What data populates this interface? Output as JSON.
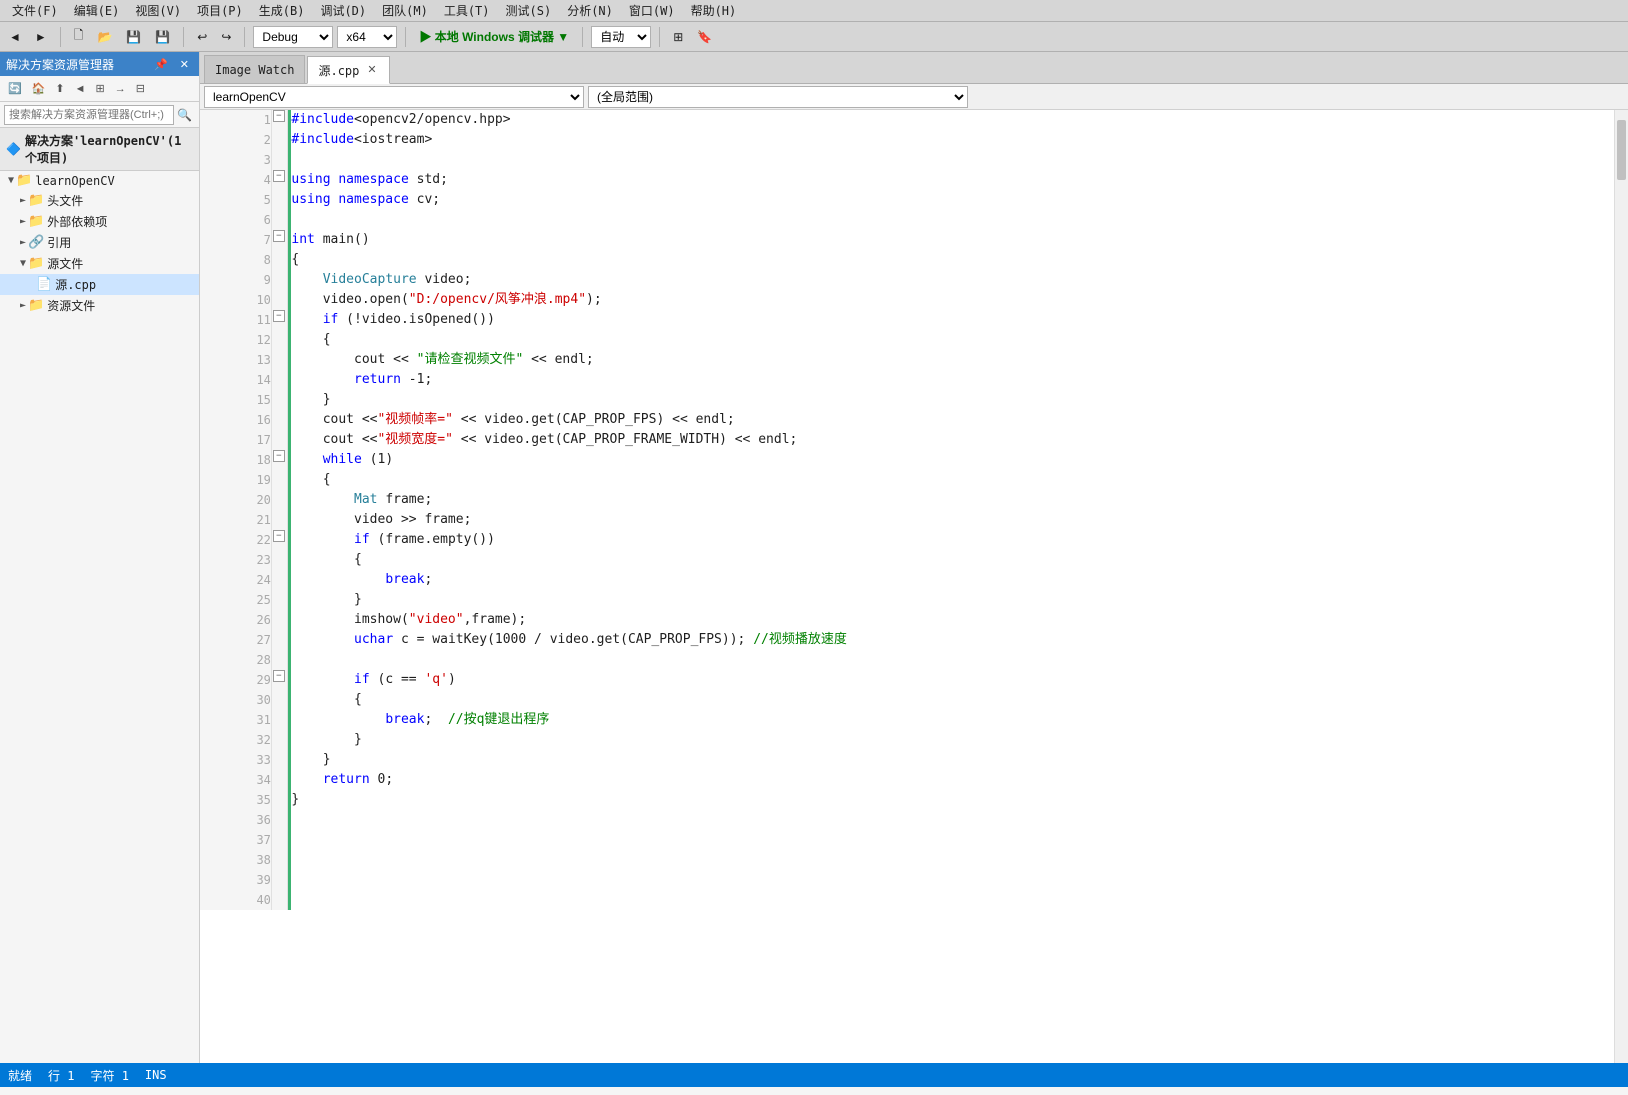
{
  "menubar": {
    "items": [
      "文件(F)",
      "编辑(E)",
      "视图(V)",
      "项目(P)",
      "生成(B)",
      "调试(D)",
      "团队(M)",
      "工具(T)",
      "测试(S)",
      "分析(N)",
      "窗口(W)",
      "帮助(H)"
    ]
  },
  "toolbar": {
    "debug_config": "Debug",
    "platform": "x64",
    "run_label": "本地 Windows 调试器",
    "auto_label": "自动"
  },
  "left_panel": {
    "title": "解决方案资源管理器",
    "search_placeholder": "搜索解决方案资源管理器(Ctrl+;)",
    "solution_label": "解决方案'learnOpenCV'(1 个项目)",
    "tree": [
      {
        "label": "learnOpenCV",
        "indent": 0,
        "type": "project",
        "expanded": true
      },
      {
        "label": "头文件",
        "indent": 1,
        "type": "folder",
        "expanded": false
      },
      {
        "label": "外部依赖项",
        "indent": 1,
        "type": "folder",
        "expanded": false
      },
      {
        "label": "引用",
        "indent": 1,
        "type": "folder",
        "expanded": false
      },
      {
        "label": "源文件",
        "indent": 1,
        "type": "folder",
        "expanded": true
      },
      {
        "label": "源.cpp",
        "indent": 2,
        "type": "cpp",
        "expanded": false
      },
      {
        "label": "资源文件",
        "indent": 1,
        "type": "folder",
        "expanded": false
      }
    ]
  },
  "tabs": {
    "image_watch": {
      "label": "Image Watch",
      "active": false
    },
    "source_cpp": {
      "label": "源.cpp",
      "active": true,
      "modified": true
    }
  },
  "nav_bar": {
    "scope": "learnOpenCV",
    "location": "(全局范围)"
  },
  "code": {
    "lines": [
      {
        "ln": 1,
        "collapse": true,
        "content": "#include<opencv2/opencv.hpp>",
        "tokens": [
          {
            "text": "#include",
            "cls": "kw-blue"
          },
          {
            "text": "<opencv2/opencv.hpp>",
            "cls": "plain"
          }
        ]
      },
      {
        "ln": 2,
        "collapse": false,
        "content": "#include<iostream>",
        "tokens": [
          {
            "text": "#include",
            "cls": "kw-blue"
          },
          {
            "text": "<iostream>",
            "cls": "plain"
          }
        ]
      },
      {
        "ln": 3,
        "collapse": false,
        "content": "",
        "tokens": []
      },
      {
        "ln": 4,
        "collapse": true,
        "content": "using namespace std;",
        "tokens": [
          {
            "text": "using namespace ",
            "cls": "kw-blue"
          },
          {
            "text": "std",
            "cls": "plain"
          },
          {
            "text": ";",
            "cls": "plain"
          }
        ]
      },
      {
        "ln": 5,
        "collapse": false,
        "content": "using namespace cv;",
        "tokens": [
          {
            "text": "using namespace ",
            "cls": "kw-blue"
          },
          {
            "text": "cv",
            "cls": "plain"
          },
          {
            "text": ";",
            "cls": "plain"
          }
        ]
      },
      {
        "ln": 6,
        "collapse": false,
        "content": "",
        "tokens": []
      },
      {
        "ln": 7,
        "collapse": true,
        "content": "int main()",
        "tokens": [
          {
            "text": "int ",
            "cls": "kw-blue"
          },
          {
            "text": "main",
            "cls": "plain"
          },
          {
            "text": "()",
            "cls": "plain"
          }
        ]
      },
      {
        "ln": 8,
        "collapse": false,
        "content": "{",
        "tokens": [
          {
            "text": "{",
            "cls": "plain"
          }
        ]
      },
      {
        "ln": 9,
        "collapse": false,
        "content": "    VideoCapture video;",
        "tokens": [
          {
            "text": "    ",
            "cls": "plain"
          },
          {
            "text": "VideoCapture",
            "cls": "cls-teal"
          },
          {
            "text": " video;",
            "cls": "plain"
          }
        ]
      },
      {
        "ln": 10,
        "collapse": false,
        "content": "    video.open(\"D:/opencv/风筝冲浪.mp4\");",
        "tokens": [
          {
            "text": "    video.open(",
            "cls": "plain"
          },
          {
            "text": "\"D:/opencv/风筝冲浪.mp4\"",
            "cls": "str-red"
          },
          {
            "text": ");",
            "cls": "plain"
          }
        ]
      },
      {
        "ln": 11,
        "collapse": true,
        "content": "    if (!video.isOpened())",
        "tokens": [
          {
            "text": "    ",
            "cls": "plain"
          },
          {
            "text": "if",
            "cls": "kw-blue"
          },
          {
            "text": " (!video.isOpened())",
            "cls": "plain"
          }
        ]
      },
      {
        "ln": 12,
        "collapse": false,
        "content": "    {",
        "tokens": [
          {
            "text": "    {",
            "cls": "plain"
          }
        ]
      },
      {
        "ln": 13,
        "collapse": false,
        "content": "        cout << \"请检查视频文件\" << endl;",
        "tokens": [
          {
            "text": "        cout << ",
            "cls": "plain"
          },
          {
            "text": "\"请检查视频文件\"",
            "cls": "str-green"
          },
          {
            "text": " << endl;",
            "cls": "plain"
          }
        ]
      },
      {
        "ln": 14,
        "collapse": false,
        "content": "        return -1;",
        "tokens": [
          {
            "text": "        ",
            "cls": "plain"
          },
          {
            "text": "return",
            "cls": "kw-blue"
          },
          {
            "text": " -1;",
            "cls": "plain"
          }
        ]
      },
      {
        "ln": 15,
        "collapse": false,
        "content": "    }",
        "tokens": [
          {
            "text": "    }",
            "cls": "plain"
          }
        ]
      },
      {
        "ln": 16,
        "collapse": false,
        "content": "    cout <<\"视频帧率=\" << video.get(CAP_PROP_FPS) << endl;",
        "tokens": [
          {
            "text": "    cout <<",
            "cls": "plain"
          },
          {
            "text": "\"视频帧率=\"",
            "cls": "str-red"
          },
          {
            "text": " << video.get(CAP_PROP_FPS) << endl;",
            "cls": "plain"
          }
        ]
      },
      {
        "ln": 17,
        "collapse": false,
        "content": "    cout <<\"视频宽度=\" << video.get(CAP_PROP_FRAME_WIDTH) << endl;",
        "tokens": [
          {
            "text": "    cout <<",
            "cls": "plain"
          },
          {
            "text": "\"视频宽度=\"",
            "cls": "str-red"
          },
          {
            "text": " << video.get(CAP_PROP_FRAME_WIDTH) << endl;",
            "cls": "plain"
          }
        ]
      },
      {
        "ln": 18,
        "collapse": true,
        "content": "    while (1)",
        "tokens": [
          {
            "text": "    ",
            "cls": "plain"
          },
          {
            "text": "while",
            "cls": "kw-blue"
          },
          {
            "text": " (1)",
            "cls": "plain"
          }
        ]
      },
      {
        "ln": 19,
        "collapse": false,
        "content": "    {",
        "tokens": [
          {
            "text": "    {",
            "cls": "plain"
          }
        ]
      },
      {
        "ln": 20,
        "collapse": false,
        "content": "        Mat frame;",
        "tokens": [
          {
            "text": "        ",
            "cls": "plain"
          },
          {
            "text": "Mat",
            "cls": "cls-teal"
          },
          {
            "text": " frame;",
            "cls": "plain"
          }
        ]
      },
      {
        "ln": 21,
        "collapse": false,
        "content": "        video >> frame;",
        "tokens": [
          {
            "text": "        video >> frame;",
            "cls": "plain"
          }
        ]
      },
      {
        "ln": 22,
        "collapse": true,
        "content": "        if (frame.empty())",
        "tokens": [
          {
            "text": "        ",
            "cls": "plain"
          },
          {
            "text": "if",
            "cls": "kw-blue"
          },
          {
            "text": " (frame.empty())",
            "cls": "plain"
          }
        ]
      },
      {
        "ln": 23,
        "collapse": false,
        "content": "        {",
        "tokens": [
          {
            "text": "        {",
            "cls": "plain"
          }
        ]
      },
      {
        "ln": 24,
        "collapse": false,
        "content": "            break;",
        "tokens": [
          {
            "text": "            ",
            "cls": "plain"
          },
          {
            "text": "break",
            "cls": "kw-blue"
          },
          {
            "text": ";",
            "cls": "plain"
          }
        ]
      },
      {
        "ln": 25,
        "collapse": false,
        "content": "        }",
        "tokens": [
          {
            "text": "        }",
            "cls": "plain"
          }
        ]
      },
      {
        "ln": 26,
        "collapse": false,
        "content": "        imshow(\"video\",frame);",
        "tokens": [
          {
            "text": "        imshow(",
            "cls": "plain"
          },
          {
            "text": "\"video\"",
            "cls": "str-red"
          },
          {
            "text": ",frame);",
            "cls": "plain"
          }
        ]
      },
      {
        "ln": 27,
        "collapse": false,
        "content": "        uchar c = waitKey(1000 / video.get(CAP_PROP_FPS)); //视频播放速度",
        "tokens": [
          {
            "text": "        ",
            "cls": "plain"
          },
          {
            "text": "uchar",
            "cls": "kw-blue"
          },
          {
            "text": " c = waitKey(1000 / video.get(CAP_PROP_FPS)); ",
            "cls": "plain"
          },
          {
            "text": "//视频播放速度",
            "cls": "comment-green"
          }
        ]
      },
      {
        "ln": 28,
        "collapse": false,
        "content": "",
        "tokens": []
      },
      {
        "ln": 29,
        "collapse": true,
        "content": "        if (c == 'q')",
        "tokens": [
          {
            "text": "        ",
            "cls": "plain"
          },
          {
            "text": "if",
            "cls": "kw-blue"
          },
          {
            "text": " (c == ",
            "cls": "plain"
          },
          {
            "text": "'q'",
            "cls": "str-red"
          },
          {
            "text": ")",
            "cls": "plain"
          }
        ]
      },
      {
        "ln": 30,
        "collapse": false,
        "content": "        {",
        "tokens": [
          {
            "text": "        {",
            "cls": "plain"
          }
        ]
      },
      {
        "ln": 31,
        "collapse": false,
        "content": "            break;  //按q键退出程序",
        "tokens": [
          {
            "text": "            ",
            "cls": "plain"
          },
          {
            "text": "break",
            "cls": "kw-blue"
          },
          {
            "text": ";  ",
            "cls": "plain"
          },
          {
            "text": "//按q键退出程序",
            "cls": "comment-green"
          }
        ]
      },
      {
        "ln": 32,
        "collapse": false,
        "content": "        }",
        "tokens": [
          {
            "text": "        }",
            "cls": "plain"
          }
        ]
      },
      {
        "ln": 33,
        "collapse": false,
        "content": "    }",
        "tokens": [
          {
            "text": "    }",
            "cls": "plain"
          }
        ]
      },
      {
        "ln": 34,
        "collapse": false,
        "content": "    return 0;",
        "tokens": [
          {
            "text": "    ",
            "cls": "plain"
          },
          {
            "text": "return",
            "cls": "kw-blue"
          },
          {
            "text": " 0;",
            "cls": "plain"
          }
        ]
      },
      {
        "ln": 35,
        "collapse": false,
        "content": "}",
        "tokens": [
          {
            "text": "}",
            "cls": "plain"
          }
        ]
      },
      {
        "ln": 36,
        "collapse": false,
        "content": "",
        "tokens": []
      },
      {
        "ln": 37,
        "collapse": false,
        "content": "",
        "tokens": []
      },
      {
        "ln": 38,
        "collapse": false,
        "content": "",
        "tokens": []
      },
      {
        "ln": 39,
        "collapse": false,
        "content": "",
        "tokens": []
      },
      {
        "ln": 40,
        "collapse": false,
        "content": "",
        "tokens": []
      }
    ]
  },
  "status_bar": {
    "items": [
      "",
      ""
    ]
  }
}
